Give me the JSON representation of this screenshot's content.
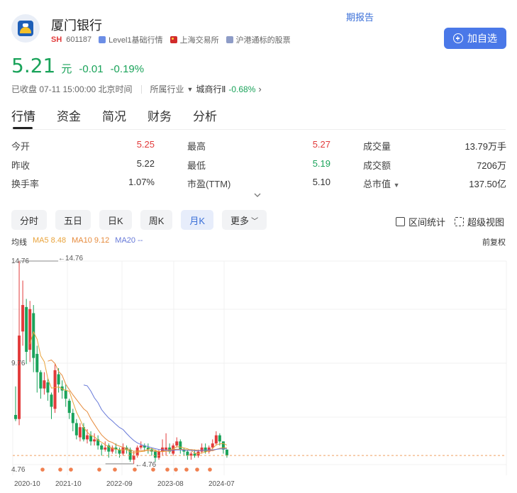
{
  "header": {
    "periodic_report": "期报告",
    "name": "厦门银行",
    "market": "SH",
    "code": "601187",
    "tags": [
      {
        "label": "Level1基础行情",
        "icon": "level1-icon"
      },
      {
        "label": "上海交易所",
        "icon": "sse-flag-icon"
      },
      {
        "label": "沪港通标的股票",
        "icon": "hk-connect-icon"
      }
    ],
    "add_button": "加自选"
  },
  "quote": {
    "price": "5.21",
    "unit": "元",
    "change": "-0.01",
    "change_pct": "-0.19%",
    "status": "已收盘 07-11 15:00:00 北京时间",
    "industry_label": "所属行业",
    "industry_name": "城商行Ⅱ",
    "industry_change": "-0.68%"
  },
  "tabs": [
    "行情",
    "资金",
    "简况",
    "财务",
    "分析"
  ],
  "metrics": [
    [
      {
        "label": "今开",
        "value": "5.25"
      },
      {
        "label": "最高",
        "value": "5.27"
      },
      {
        "label": "成交量",
        "value": "13.79万手"
      }
    ],
    [
      {
        "label": "昨收",
        "value": "5.22"
      },
      {
        "label": "最低",
        "value": "5.19"
      },
      {
        "label": "成交额",
        "value": "7206万"
      }
    ],
    [
      {
        "label": "换手率",
        "value": "1.07%"
      },
      {
        "label": "市盈(TTM)",
        "value": "5.10"
      },
      {
        "label": "总市值",
        "value": "137.50亿"
      }
    ]
  ],
  "periods": [
    "分时",
    "五日",
    "日K",
    "周K",
    "月K",
    "更多"
  ],
  "active_period": "月K",
  "tools": {
    "range_stats": "区间统计",
    "super_view": "超级视图"
  },
  "ma": {
    "title": "均线",
    "ma5": "MA5 8.48",
    "ma10": "MA10 9.12",
    "ma20": "MA20 --"
  },
  "fuquan": "前复权",
  "colors": {
    "up": "#e23b3b",
    "down": "#1aa35a",
    "accent": "#4a78e8",
    "ma5": "#e9a33b",
    "ma10": "#e68a3b",
    "ma20": "#6678d8"
  },
  "chart_data": {
    "type": "candlestick",
    "y_labels": [
      "14.76",
      "9.76",
      "4.76"
    ],
    "high_marker": "14.76",
    "low_marker": "4.76",
    "x_labels": [
      "2020-10",
      "2021-10",
      "2022-09",
      "2023-08",
      "2024-07"
    ],
    "ylim": [
      4.76,
      14.76
    ],
    "candles": [
      [
        7.2,
        7.0,
        8.6,
        6.9
      ],
      [
        7.0,
        11.1,
        14.76,
        6.7
      ],
      [
        11.3,
        12.6,
        13.8,
        10.6
      ],
      [
        12.5,
        10.3,
        12.9,
        9.7
      ],
      [
        10.4,
        12.4,
        12.8,
        9.8
      ],
      [
        12.2,
        10.0,
        12.6,
        9.3
      ],
      [
        10.2,
        9.3,
        10.6,
        8.3
      ],
      [
        9.3,
        8.5,
        9.4,
        8.0
      ],
      [
        8.5,
        8.9,
        9.3,
        8.2
      ],
      [
        8.8,
        8.3,
        9.0,
        7.9
      ],
      [
        8.2,
        7.6,
        8.3,
        7.0
      ],
      [
        7.5,
        9.4,
        9.7,
        7.3
      ],
      [
        9.2,
        8.7,
        9.5,
        8.3
      ],
      [
        8.6,
        8.4,
        8.9,
        8.0
      ],
      [
        8.4,
        8.0,
        8.7,
        7.6
      ],
      [
        7.9,
        7.3,
        8.0,
        7.0
      ],
      [
        7.3,
        6.8,
        7.5,
        6.4
      ],
      [
        6.8,
        6.2,
        7.0,
        6.0
      ],
      [
        6.1,
        6.6,
        6.8,
        5.9
      ],
      [
        6.6,
        6.0,
        6.8,
        5.9
      ],
      [
        6.0,
        6.2,
        6.5,
        5.8
      ],
      [
        6.2,
        5.9,
        6.4,
        5.7
      ],
      [
        5.9,
        6.0,
        6.3,
        5.7
      ],
      [
        6.0,
        5.7,
        6.2,
        5.5
      ],
      [
        5.7,
        5.5,
        5.8,
        5.2
      ],
      [
        5.5,
        5.6,
        5.9,
        5.4
      ],
      [
        5.7,
        5.4,
        5.8,
        5.1
      ],
      [
        5.4,
        5.6,
        5.7,
        5.3
      ],
      [
        5.6,
        5.5,
        5.8,
        5.3
      ],
      [
        5.5,
        5.3,
        5.6,
        5.1
      ],
      [
        5.3,
        5.6,
        5.8,
        5.2
      ],
      [
        5.6,
        5.5,
        5.7,
        5.3
      ],
      [
        5.5,
        5.0,
        5.6,
        4.9
      ],
      [
        5.0,
        5.2,
        5.4,
        4.8
      ],
      [
        5.2,
        5.6,
        5.7,
        5.1
      ],
      [
        5.6,
        5.7,
        5.9,
        5.5
      ],
      [
        5.7,
        5.6,
        5.8,
        5.4
      ],
      [
        5.6,
        5.5,
        5.8,
        5.3
      ],
      [
        5.5,
        5.4,
        5.6,
        5.2
      ],
      [
        5.4,
        5.1,
        5.5,
        4.9
      ],
      [
        5.1,
        5.4,
        5.5,
        5.0
      ],
      [
        5.4,
        5.6,
        6.0,
        5.2
      ],
      [
        5.5,
        5.6,
        6.3,
        5.2
      ],
      [
        5.6,
        5.4,
        5.8,
        5.3
      ],
      [
        5.3,
        5.7,
        5.8,
        5.2
      ],
      [
        5.7,
        5.9,
        6.1,
        5.6
      ],
      [
        5.9,
        5.5,
        6.0,
        5.3
      ],
      [
        5.5,
        5.4,
        5.6,
        5.2
      ],
      [
        5.4,
        5.2,
        5.5,
        5.0
      ],
      [
        5.2,
        5.3,
        5.4,
        5.0
      ],
      [
        5.3,
        5.2,
        5.5,
        5.1
      ],
      [
        5.2,
        5.4,
        5.5,
        5.1
      ],
      [
        5.4,
        5.6,
        5.8,
        5.3
      ],
      [
        5.6,
        5.4,
        5.8,
        5.3
      ],
      [
        5.4,
        5.6,
        5.7,
        5.3
      ],
      [
        5.6,
        5.8,
        6.0,
        5.5
      ],
      [
        5.8,
        6.2,
        6.4,
        5.7
      ],
      [
        6.2,
        5.9,
        6.3,
        5.7
      ],
      [
        5.9,
        5.5,
        5.9,
        5.3
      ],
      [
        5.5,
        5.21,
        5.5,
        5.1
      ]
    ],
    "dividend_markers": 12
  }
}
